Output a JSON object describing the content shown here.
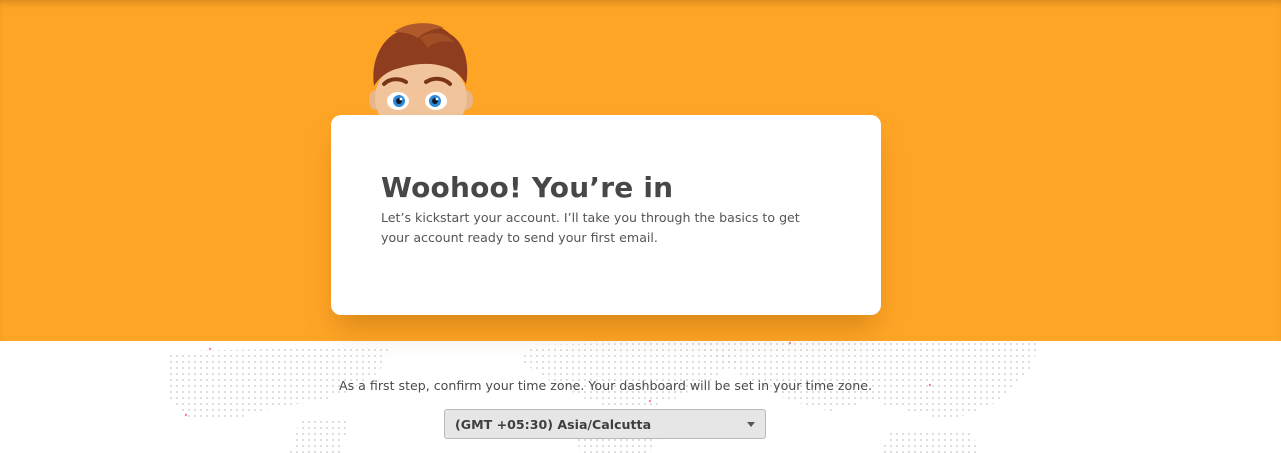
{
  "hero": {
    "background_color": "#FFA526",
    "mascot_icon": "cartoon-boy-peeking-icon"
  },
  "welcome_card": {
    "title": "Woohoo! You’re in",
    "description": "Let’s kickstart your account. I’ll take you through the basics to get your account ready to send your first email."
  },
  "timezone": {
    "instruction": "As a first step, confirm your time zone. Your dashboard will be set in your time zone.",
    "selected_value": "(GMT +05:30) Asia/Calcutta",
    "dropdown_icon": "caret-down-icon"
  }
}
